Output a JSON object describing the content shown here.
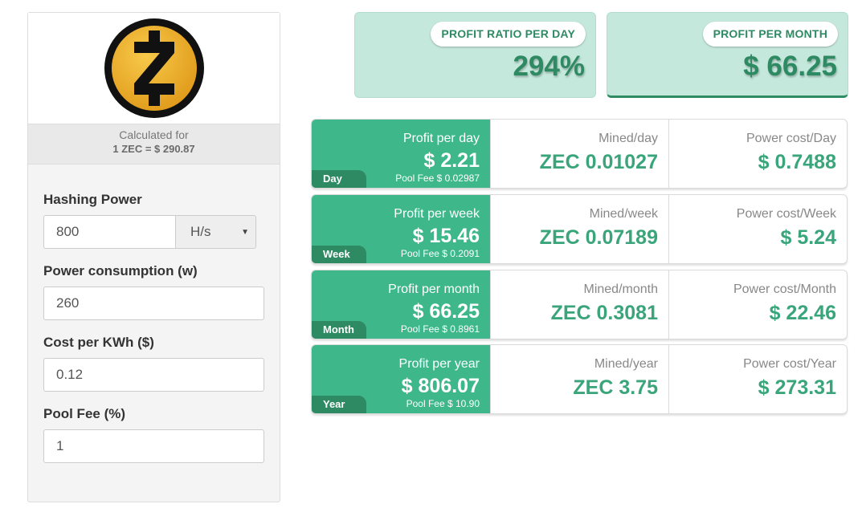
{
  "coin": {
    "logo_icon": "zcash-logo-icon",
    "calculated_for_label": "Calculated for",
    "rate_text": "1 ZEC = $ 290.87"
  },
  "form": {
    "hashing_power": {
      "label": "Hashing Power",
      "value": "800",
      "unit": "H/s"
    },
    "power_consumption": {
      "label": "Power consumption (w)",
      "value": "260"
    },
    "cost_per_kwh": {
      "label": "Cost per KWh ($)",
      "value": "0.12"
    },
    "pool_fee": {
      "label": "Pool Fee (%)",
      "value": "1"
    }
  },
  "summary": {
    "ratio": {
      "label": "PROFIT RATIO PER DAY",
      "value": "294%"
    },
    "month": {
      "label": "PROFIT PER MONTH",
      "value": "$ 66.25"
    }
  },
  "rows": [
    {
      "period": "Day",
      "profit_label": "Profit per day",
      "profit_value": "$ 2.21",
      "pool_fee": "Pool Fee $ 0.02987",
      "mined_label": "Mined/day",
      "mined_value": "ZEC 0.01027",
      "power_label": "Power cost/Day",
      "power_value": "$ 0.7488"
    },
    {
      "period": "Week",
      "profit_label": "Profit per week",
      "profit_value": "$ 15.46",
      "pool_fee": "Pool Fee $ 0.2091",
      "mined_label": "Mined/week",
      "mined_value": "ZEC 0.07189",
      "power_label": "Power cost/Week",
      "power_value": "$ 5.24"
    },
    {
      "period": "Month",
      "profit_label": "Profit per month",
      "profit_value": "$ 66.25",
      "pool_fee": "Pool Fee $ 0.8961",
      "mined_label": "Mined/month",
      "mined_value": "ZEC 0.3081",
      "power_label": "Power cost/Month",
      "power_value": "$ 22.46"
    },
    {
      "period": "Year",
      "profit_label": "Profit per year",
      "profit_value": "$ 806.07",
      "pool_fee": "Pool Fee $ 10.90",
      "mined_label": "Mined/year",
      "mined_value": "ZEC 3.75",
      "power_label": "Power cost/Year",
      "power_value": "$ 273.31"
    }
  ],
  "colors": {
    "accent_green": "#3eb88b",
    "dark_green": "#2e8a63",
    "summary_bg": "#c5e8dc",
    "logo_gold": "#f4b728"
  }
}
